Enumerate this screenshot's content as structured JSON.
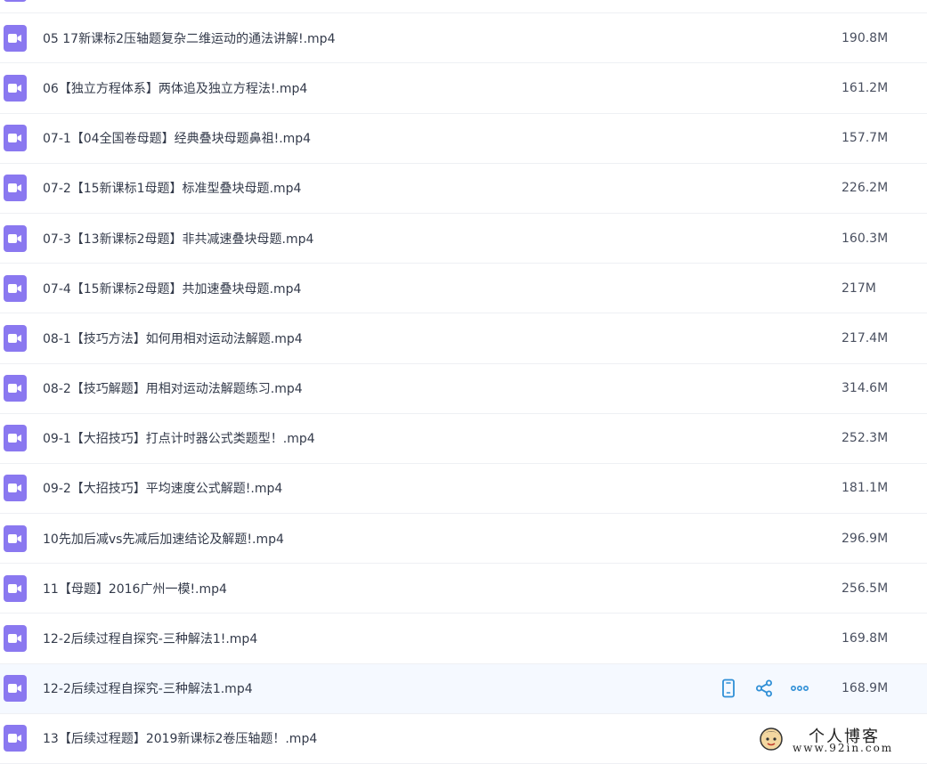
{
  "files": [
    {
      "name": "",
      "size": ""
    },
    {
      "name": "05 17新课标2压轴题复杂二维运动的通法讲解!.mp4",
      "size": "190.8M"
    },
    {
      "name": "06【独立方程体系】两体追及独立方程法!.mp4",
      "size": "161.2M"
    },
    {
      "name": "07-1【04全国卷母题】经典叠块母题鼻祖!.mp4",
      "size": "157.7M"
    },
    {
      "name": "07-2【15新课标1母题】标准型叠块母题.mp4",
      "size": "226.2M"
    },
    {
      "name": "07-3【13新课标2母题】非共减速叠块母题.mp4",
      "size": "160.3M"
    },
    {
      "name": "07-4【15新课标2母题】共加速叠块母题.mp4",
      "size": "217M"
    },
    {
      "name": "08-1【技巧方法】如何用相对运动法解题.mp4",
      "size": "217.4M"
    },
    {
      "name": "08-2【技巧解题】用相对运动法解题练习.mp4",
      "size": "314.6M"
    },
    {
      "name": "09-1【大招技巧】打点计时器公式类题型！.mp4",
      "size": "252.3M"
    },
    {
      "name": "09-2【大招技巧】平均速度公式解题!.mp4",
      "size": "181.1M"
    },
    {
      "name": "10先加后减vs先减后加速结论及解题!.mp4",
      "size": "296.9M"
    },
    {
      "name": "11【母题】2016广州一模!.mp4",
      "size": "256.5M"
    },
    {
      "name": "12-2后续过程自探究-三种解法1!.mp4",
      "size": "169.8M"
    },
    {
      "name": "12-2后续过程自探究-三种解法1.mp4",
      "size": "168.9M"
    },
    {
      "name": "13【后续过程题】2019新课标2卷压轴题！.mp4",
      "size": ""
    }
  ],
  "hover_actions": [
    "phone-icon",
    "share-icon",
    "more-icon"
  ],
  "watermark": {
    "title": "个人博客",
    "url": "www.92in.com"
  },
  "colors": {
    "file_icon": "#8a78f0",
    "action_icon": "#2f8fd6",
    "hover_row": "#f5f9ff"
  }
}
